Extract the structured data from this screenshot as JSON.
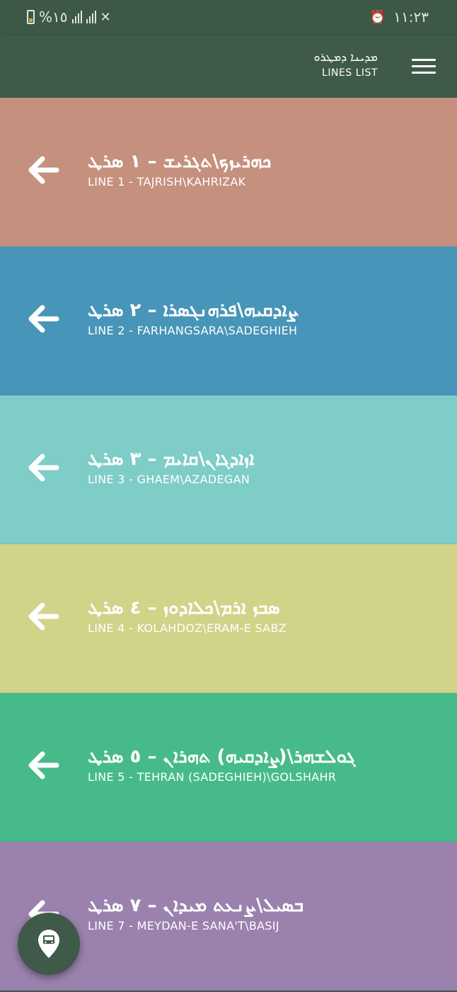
{
  "status_bar": {
    "battery_text": "%١٥",
    "time": "١١:٢٣",
    "alarm_icon": "alarm-icon"
  },
  "header": {
    "title_script": "ܡܕܝܢܐ ܕܡܛܪܘ",
    "title_latin": "LINES LIST",
    "menu_icon": "hamburger-menu-icon"
  },
  "lines": [
    {
      "script": "ܟܗܪܝܙܟ\\ܬܓܪܝܫ – ١ ܣܪܛ",
      "latin": "LINE 1 - TAJRISH\\KAHRIZAK",
      "color": "#c5907e"
    },
    {
      "script": "ܨܐܕܩܝܗ\\ܦܪܗܢܓܣܪܐ – ٢ ܣܪܛ",
      "latin": "LINE 2 - FARHANGSARA\\SADEGHIEH",
      "color": "#4795b8"
    },
    {
      "script": "ܐܙܐܕܓܐܢ\\ܩܐܝܡ – ٣ ܣܪܛ",
      "latin": "LINE 3 - GHAEM\\AZADEGAN",
      "color": "#7ecdc7"
    },
    {
      "script": "ܣܒܙ ܐܪܡ\\ܟܠܐܕܘܙ – ٤ ܣܪܛ",
      "latin": "LINE 4 - KOLAHDOZ\\ERAM-E SABZ",
      "color": "#d1d389"
    },
    {
      "script": "ܓܘܠܫܗܪ\\(ܨܐܕܩܝܗ) ܬܗܪܐܢ – ٥ ܣܪܛ",
      "latin": "LINE 5 - TEHRAN (SADEGHIEH)\\GOLSHAHR",
      "color": "#46bb89"
    },
    {
      "script": "ܒܣܝܠ\\ܨܢܥܬ ܡܝܕܐܢ – ٧ ܣܪܛ",
      "latin": "LINE 7 - MEYDAN-E SANA'T\\BASIJ",
      "color": "#9a81ae"
    }
  ],
  "fab": {
    "icon": "map-pin-train-icon"
  },
  "colors": {
    "primary": "#3f5a48",
    "text_on_primary": "#ffffff"
  }
}
